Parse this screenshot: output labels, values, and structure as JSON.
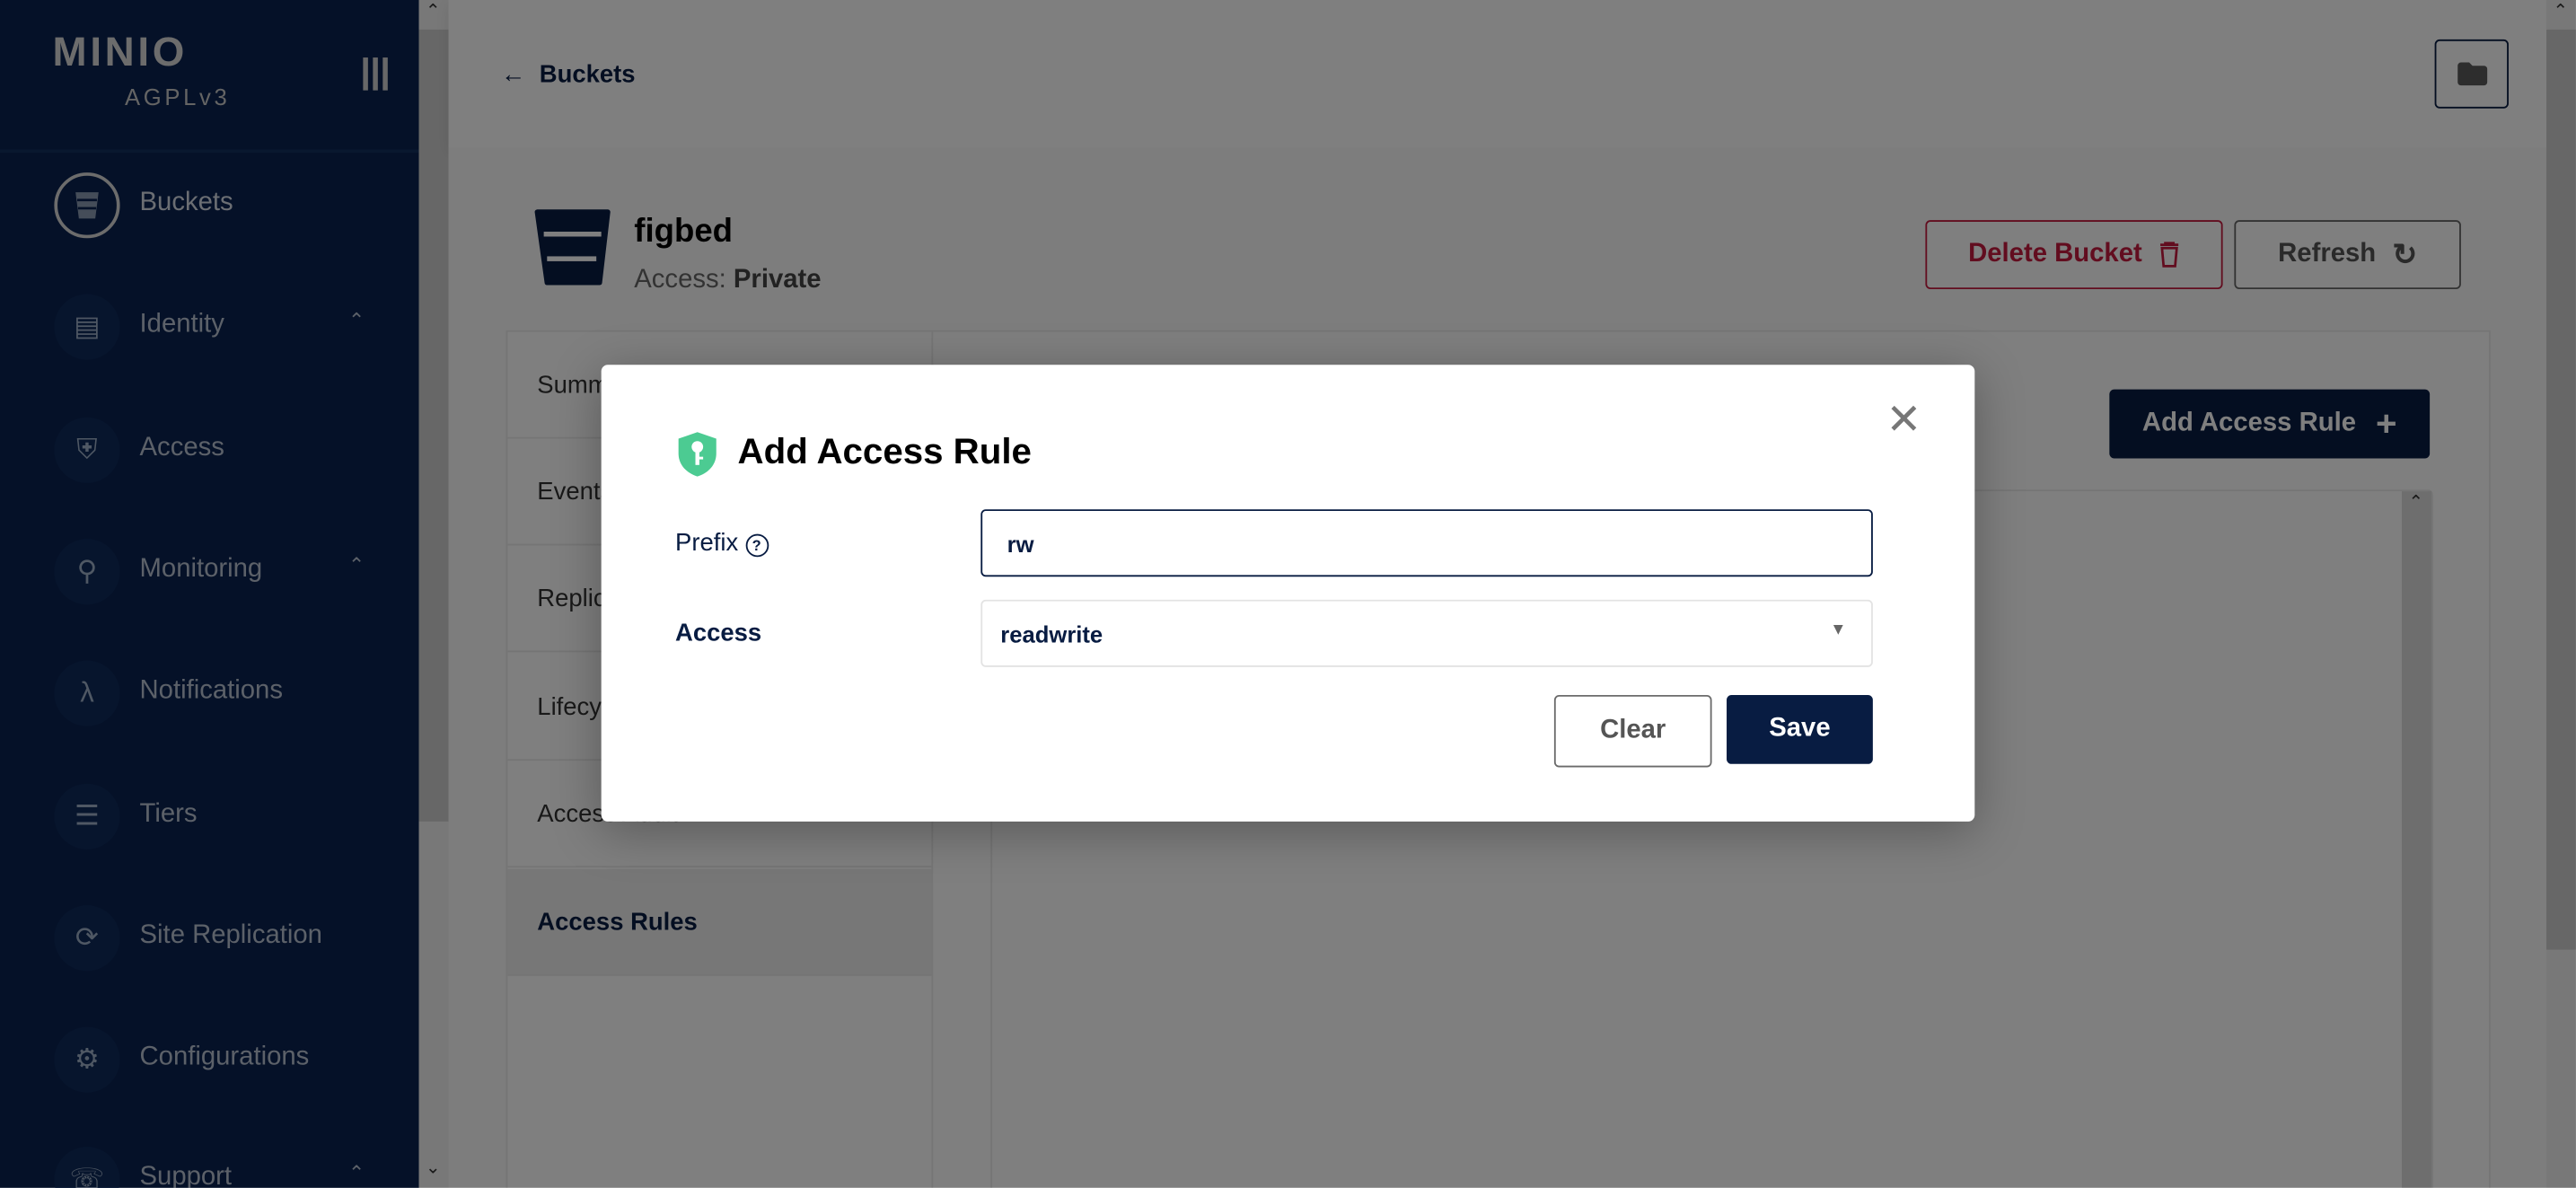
{
  "sidebar": {
    "logo": "MINIO",
    "license": "AGPLv3",
    "items": [
      {
        "label": "Buckets",
        "icon": "bucket-icon",
        "active": true
      },
      {
        "label": "Identity",
        "icon": "id-card-icon",
        "expandable": true
      },
      {
        "label": "Access",
        "icon": "shield-lock-icon"
      },
      {
        "label": "Monitoring",
        "icon": "magnifier-chart-icon",
        "expandable": true
      },
      {
        "label": "Notifications",
        "icon": "lambda-icon"
      },
      {
        "label": "Tiers",
        "icon": "layers-icon"
      },
      {
        "label": "Site Replication",
        "icon": "sync-icon"
      },
      {
        "label": "Configurations",
        "icon": "gear-icon"
      },
      {
        "label": "Support",
        "icon": "support-icon",
        "expandable": true
      }
    ]
  },
  "header": {
    "back_label": "Buckets",
    "folder_icon": "folder-icon"
  },
  "bucket": {
    "name": "figbed",
    "access_label": "Access:",
    "access_value": "Private"
  },
  "actions": {
    "delete_label": "Delete Bucket",
    "refresh_label": "Refresh"
  },
  "tabs": [
    {
      "label": "Summary"
    },
    {
      "label": "Events"
    },
    {
      "label": "Replication"
    },
    {
      "label": "Lifecycle"
    },
    {
      "label": "Access Audit"
    },
    {
      "label": "Access Rules",
      "selected": true
    }
  ],
  "content": {
    "add_rule_label": "Add Access Rule"
  },
  "dialog": {
    "title": "Add Access Rule",
    "prefix_label": "Prefix",
    "prefix_value": "rw",
    "access_label": "Access",
    "access_value": "readwrite",
    "clear_label": "Clear",
    "save_label": "Save"
  },
  "colors": {
    "brand_navy": "#081C42",
    "danger": "#C51B3F",
    "shield_green": "#4CCB92"
  }
}
